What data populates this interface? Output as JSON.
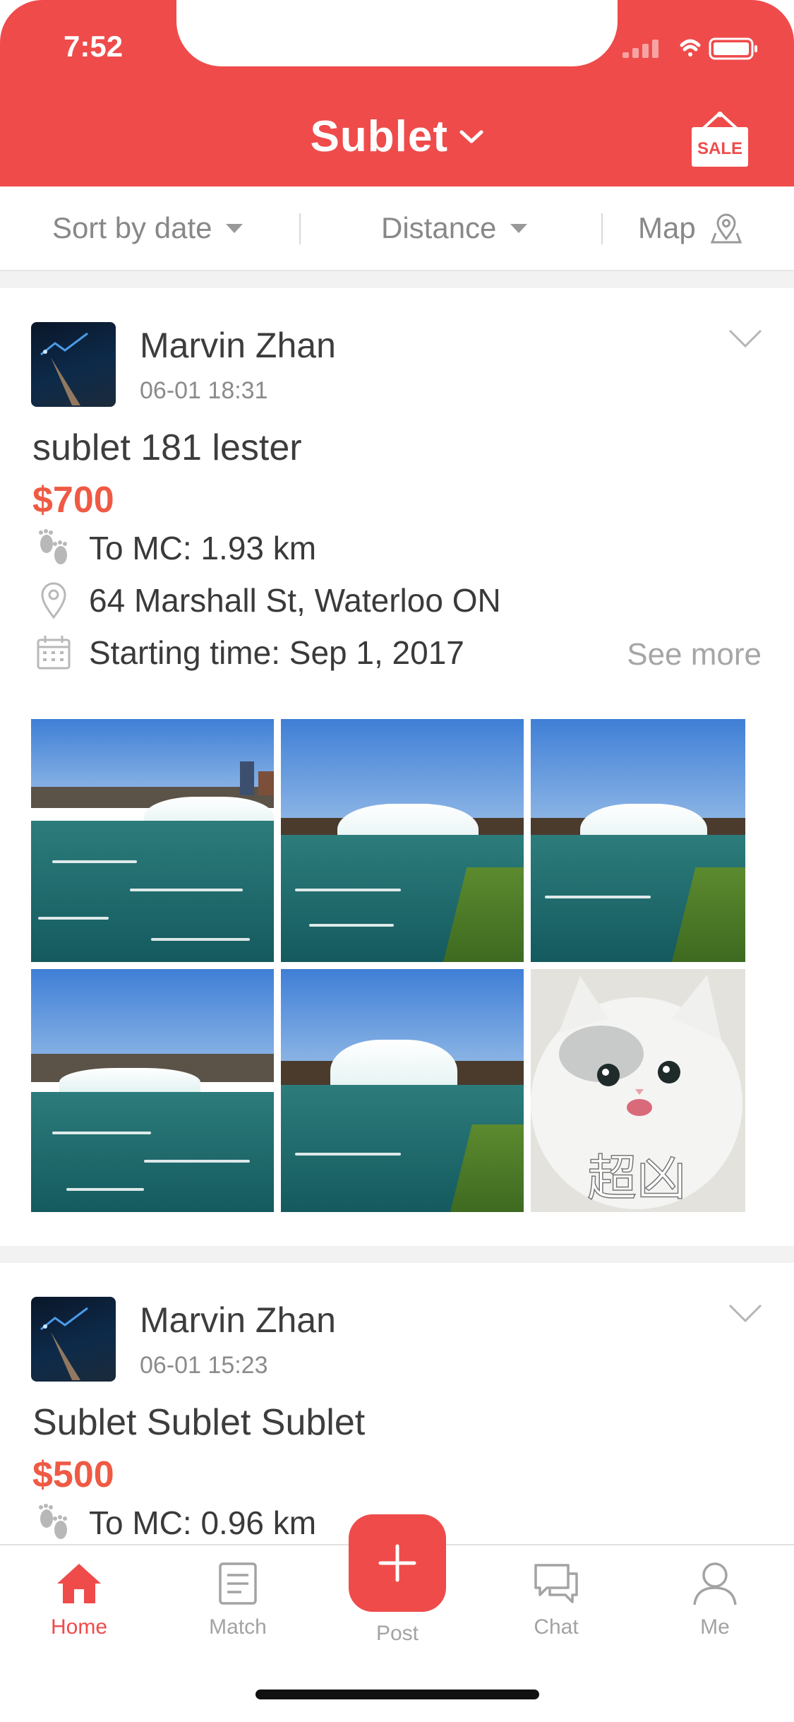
{
  "status": {
    "time": "7:52"
  },
  "header": {
    "title": "Sublet",
    "sale_label": "SALE"
  },
  "filters": {
    "sort": "Sort by date",
    "distance": "Distance",
    "map": "Map"
  },
  "posts": [
    {
      "user": "Marvin Zhan",
      "time": "06-01 18:31",
      "title": "sublet 181 lester",
      "price": "$700",
      "distance": "To MC: 1.93 km",
      "address": "64 Marshall St, Waterloo ON",
      "start": "Starting time: Sep 1, 2017",
      "see_more": "See more",
      "photo_overlay_text": "超凶"
    },
    {
      "user": "Marvin Zhan",
      "time": "06-01 15:23",
      "title": "Sublet Sublet Sublet",
      "price": "$500",
      "distance": "To MC: 0.96 km"
    }
  ],
  "tabs": [
    {
      "label": "Home",
      "icon": "home-icon",
      "active": true
    },
    {
      "label": "Match",
      "icon": "book-icon"
    },
    {
      "label": "Post",
      "icon": "plus-icon"
    },
    {
      "label": "Chat",
      "icon": "chat-icon"
    },
    {
      "label": "Me",
      "icon": "person-icon"
    }
  ],
  "colors": {
    "accent": "#ef4b4b",
    "price": "#ef5a45"
  }
}
